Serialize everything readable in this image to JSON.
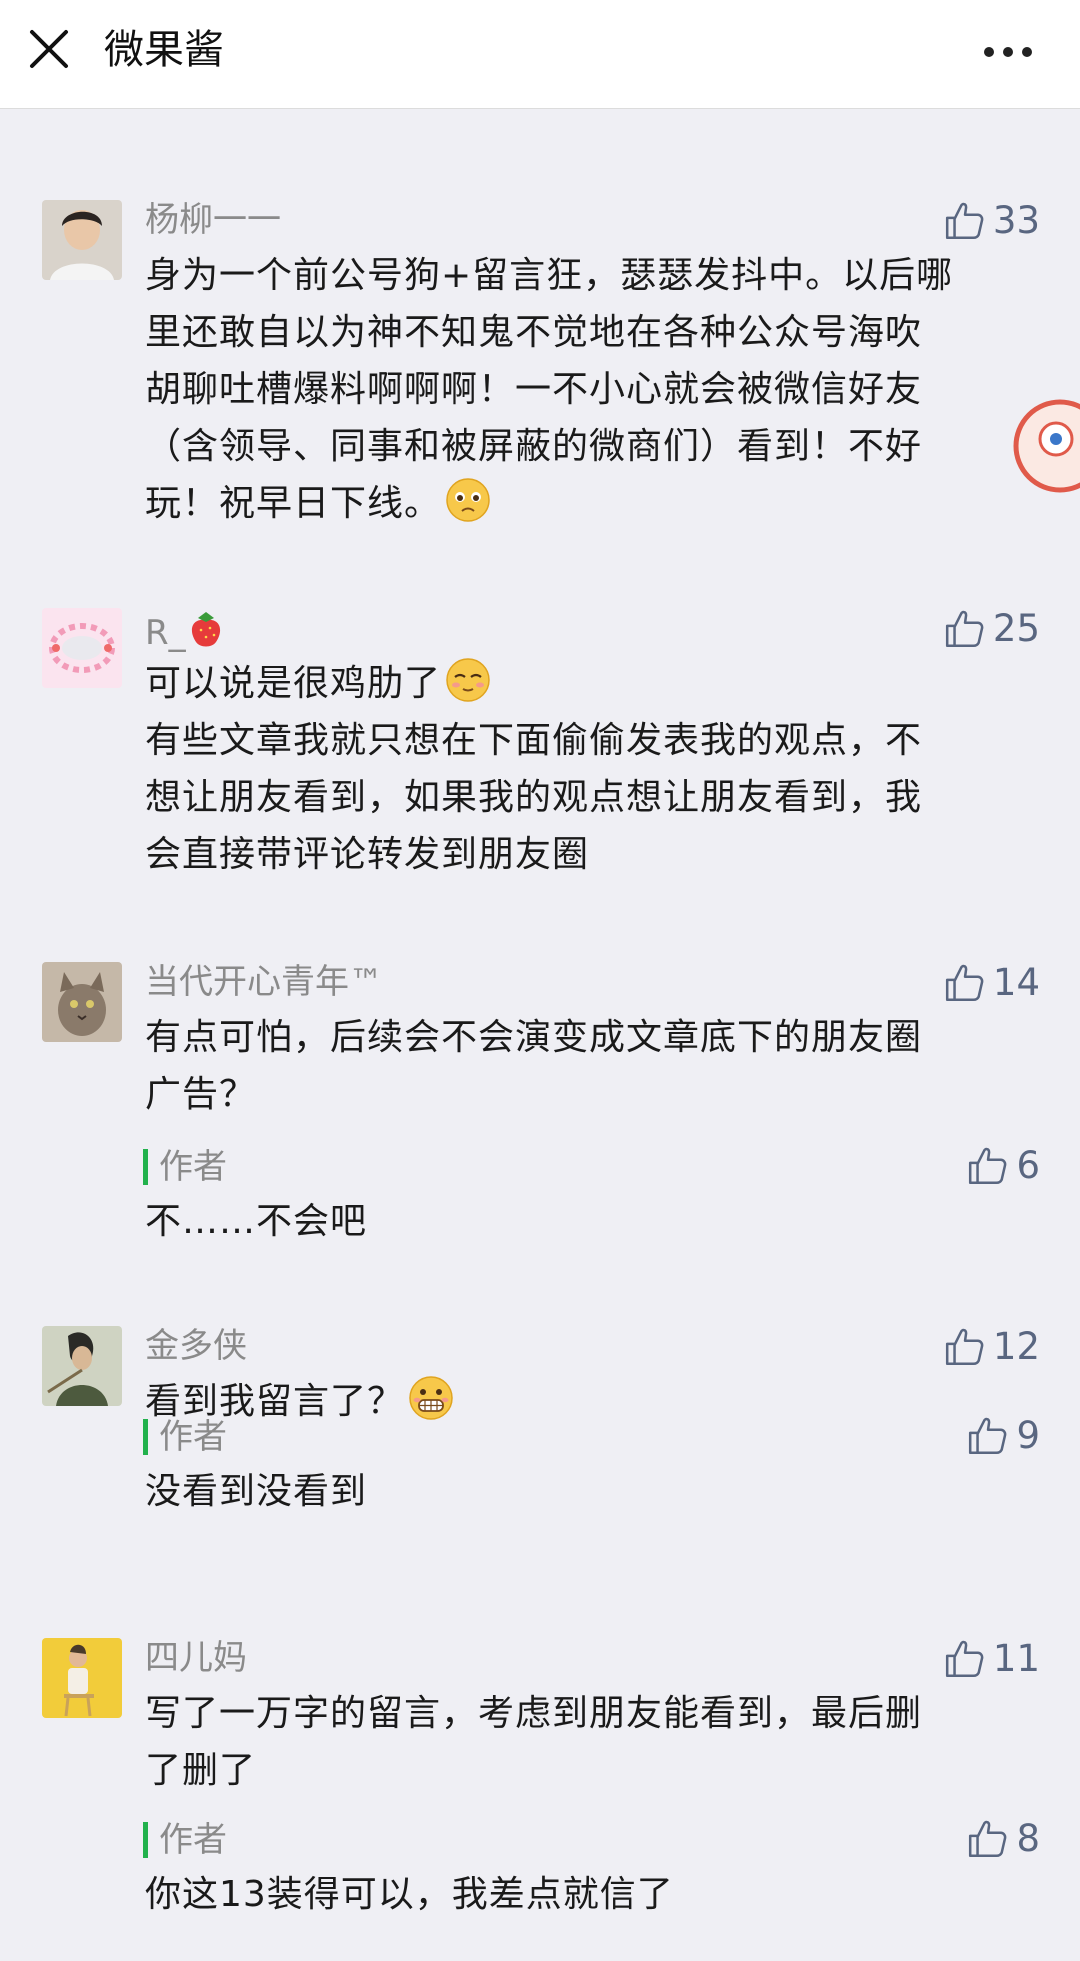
{
  "header": {
    "title": "微果酱",
    "close_icon": "close-icon",
    "more_icon": "more-icon"
  },
  "colors": {
    "accent_green": "#22b14c",
    "like_blue": "#596680",
    "background": "#efeff4"
  },
  "comments": [
    {
      "nickname": "杨柳一一",
      "likes": "33",
      "lines": [
        "身为一个前公号狗+留言狂，瑟瑟发抖中。以后哪",
        "里还敢自以为神不知鬼不觉地在各种公众号海吹",
        "胡聊吐槽爆料啊啊啊！一不小心就会被微信好友",
        "（含领导、同事和被屏蔽的微商们）看到！不好",
        "玩！祝早日下线。"
      ],
      "emoji": "pleading-face-emoji"
    },
    {
      "nickname": "R_",
      "nickname_emoji": "strawberry-emoji",
      "likes": "25",
      "lines": [
        "可以说是很鸡肋了",
        "有些文章我就只想在下面偷偷发表我的观点，不",
        "想让朋友看到，如果我的观点想让朋友看到，我",
        "会直接带评论转发到朋友圈"
      ],
      "emoji": "relieved-face-emoji"
    },
    {
      "nickname": "当代开心青年™",
      "likes": "14",
      "lines": [
        "有点可怕，后续会不会演变成文章底下的朋友圈",
        "广告？"
      ],
      "reply": {
        "label": "作者",
        "likes": "6",
        "text": "不……不会吧"
      }
    },
    {
      "nickname": "金多侠",
      "likes": "12",
      "lines": [
        "看到我留言了？"
      ],
      "emoji": "grimacing-face-emoji",
      "reply": {
        "label": "作者",
        "likes": "9",
        "text": "没看到没看到"
      }
    },
    {
      "nickname": "四儿妈",
      "likes": "11",
      "lines": [
        "写了一万字的留言，考虑到朋友能看到，最后删",
        "了删了"
      ],
      "reply": {
        "label": "作者",
        "likes": "8",
        "text": "你这13装得可以，我差点就信了"
      }
    }
  ]
}
